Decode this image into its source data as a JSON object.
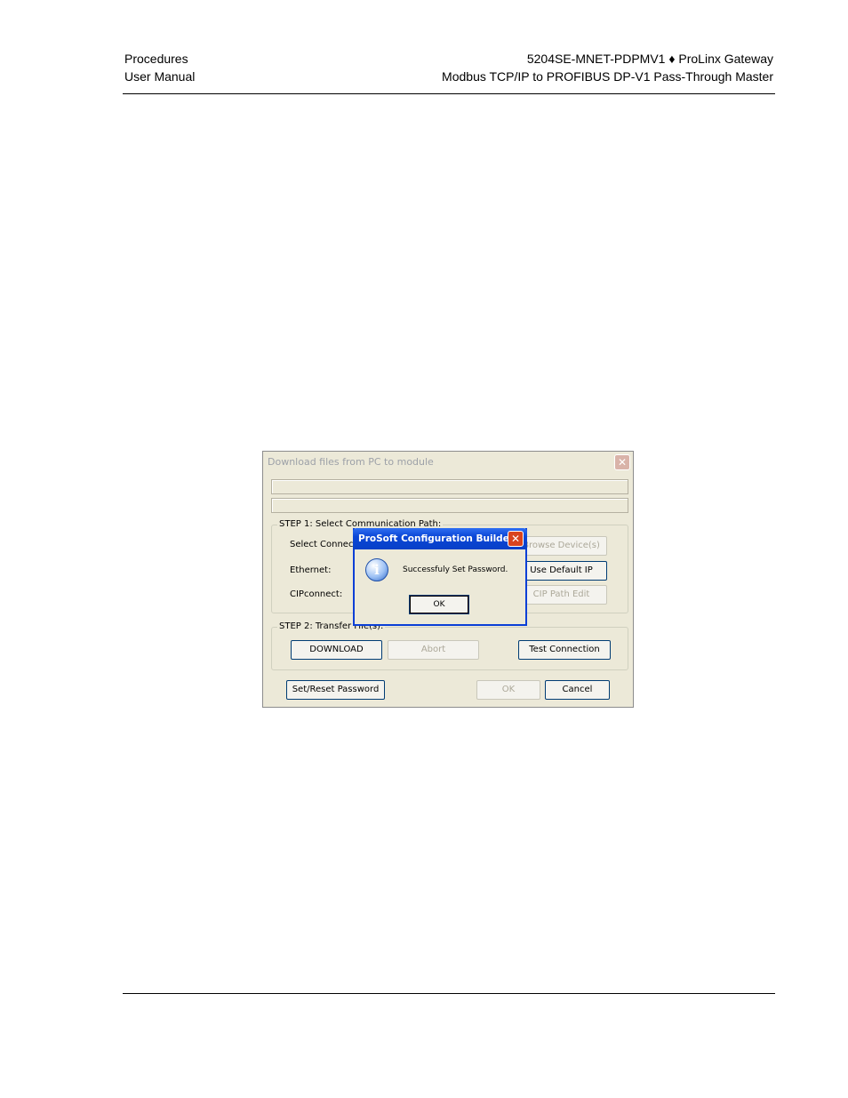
{
  "header": {
    "left_line1": "Procedures",
    "left_line2": "User Manual",
    "right_line1": "5204SE-MNET-PDPMV1 ♦ ProLinx Gateway",
    "right_line2": "Modbus TCP/IP to PROFIBUS DP-V1 Pass-Through Master"
  },
  "dialog": {
    "title": "Download files from PC to module",
    "close_glyph": "✕",
    "step1": {
      "legend": "STEP 1: Select Communication Path:",
      "select_connection_label": "Select Connec",
      "ethernet_label": "Ethernet:",
      "cipconnect_label": "CIPconnect:",
      "browse_device_button": "Browse Device(s)",
      "use_default_ip_button": "Use Default IP",
      "cip_path_edit_button": "CIP Path Edit"
    },
    "step2": {
      "legend": "STEP 2: Transfer File(s):",
      "download_button": "DOWNLOAD",
      "abort_button": "Abort",
      "test_connection_button": "Test Connection"
    },
    "set_reset_password_button": "Set/Reset Password",
    "ok_button": "OK",
    "cancel_button": "Cancel"
  },
  "message_box": {
    "title": "ProSoft Configuration Builder",
    "close_glyph": "✕",
    "icon_glyph": "i",
    "message": "Successfuly Set Password.",
    "ok_button": "OK"
  }
}
